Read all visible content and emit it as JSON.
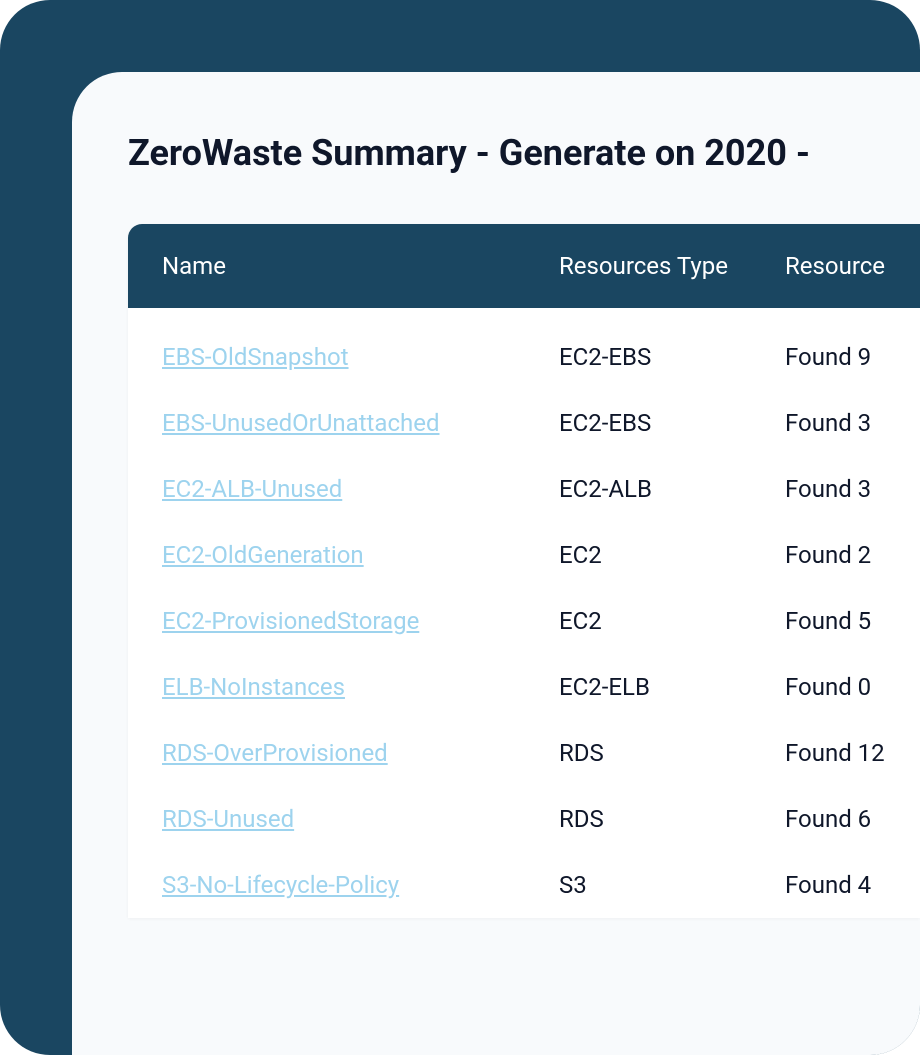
{
  "title": "ZeroWaste Summary - Generate on 2020 -",
  "table": {
    "headers": {
      "name": "Name",
      "type": "Resources Type",
      "result": "Resource"
    },
    "rows": [
      {
        "name": "EBS-OldSnapshot",
        "type": "EC2-EBS",
        "result": "Found 9"
      },
      {
        "name": "EBS-UnusedOrUnattached",
        "type": "EC2-EBS",
        "result": "Found 3"
      },
      {
        "name": "EC2-ALB-Unused",
        "type": "EC2-ALB",
        "result": "Found 3"
      },
      {
        "name": "EC2-OldGeneration",
        "type": "EC2",
        "result": "Found 2"
      },
      {
        "name": "EC2-ProvisionedStorage",
        "type": "EC2",
        "result": "Found 5"
      },
      {
        "name": "ELB-NoInstances",
        "type": "EC2-ELB",
        "result": "Found 0"
      },
      {
        "name": "RDS-OverProvisioned",
        "type": "RDS",
        "result": "Found 12"
      },
      {
        "name": "RDS-Unused",
        "type": "RDS",
        "result": "Found 6"
      },
      {
        "name": "S3-No-Lifecycle-Policy",
        "type": "S3",
        "result": "Found 4"
      }
    ]
  }
}
